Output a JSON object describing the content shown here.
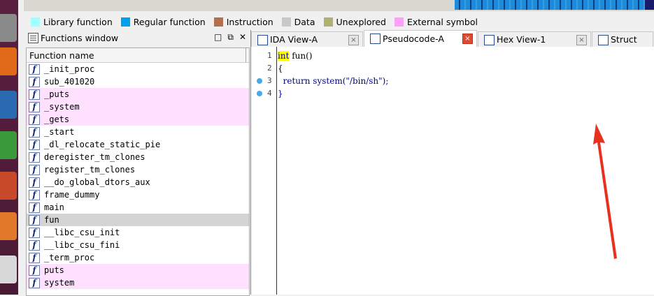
{
  "legend": [
    {
      "label": "Library function",
      "color": "#a0ffff"
    },
    {
      "label": "Regular function",
      "color": "#00a0f0"
    },
    {
      "label": "Instruction",
      "color": "#b07050"
    },
    {
      "label": "Data",
      "color": "#c8c8c8"
    },
    {
      "label": "Unexplored",
      "color": "#b0b070"
    },
    {
      "label": "External symbol",
      "color": "#ffa0ff"
    }
  ],
  "functions_window": {
    "title": "Functions window",
    "buttons": [
      "□",
      "⧉",
      "✕"
    ],
    "column_header": "Function name",
    "items": [
      {
        "name": "_init_proc",
        "type": "regular"
      },
      {
        "name": "sub_401020",
        "type": "regular"
      },
      {
        "name": "_puts",
        "type": "external"
      },
      {
        "name": "_system",
        "type": "external"
      },
      {
        "name": "_gets",
        "type": "external"
      },
      {
        "name": "_start",
        "type": "regular"
      },
      {
        "name": "_dl_relocate_static_pie",
        "type": "regular"
      },
      {
        "name": "deregister_tm_clones",
        "type": "regular"
      },
      {
        "name": "register_tm_clones",
        "type": "regular"
      },
      {
        "name": "__do_global_dtors_aux",
        "type": "regular"
      },
      {
        "name": "frame_dummy",
        "type": "regular"
      },
      {
        "name": "main",
        "type": "regular"
      },
      {
        "name": "fun",
        "type": "selected"
      },
      {
        "name": "__libc_csu_init",
        "type": "regular"
      },
      {
        "name": "__libc_csu_fini",
        "type": "regular"
      },
      {
        "name": "_term_proc",
        "type": "regular"
      },
      {
        "name": "puts",
        "type": "external"
      },
      {
        "name": "system",
        "type": "external"
      }
    ]
  },
  "tabs": [
    {
      "label": "IDA View-A",
      "active": false,
      "closable": true
    },
    {
      "label": "Pseudocode-A",
      "active": true,
      "closable": true
    },
    {
      "label": "Hex View-1",
      "active": false,
      "closable": true
    },
    {
      "label": "Struct",
      "active": false,
      "closable": false
    }
  ],
  "pseudocode": {
    "lines": [
      {
        "num": "1",
        "breakpoint": false,
        "parts": [
          {
            "t": "int",
            "c": "kw hl"
          },
          {
            "t": " fun()",
            "c": ""
          }
        ]
      },
      {
        "num": "2",
        "breakpoint": false,
        "parts": [
          {
            "t": "{",
            "c": ""
          }
        ]
      },
      {
        "num": "3",
        "breakpoint": true,
        "parts": [
          {
            "t": "  return ",
            "c": "kw"
          },
          {
            "t": "system(",
            "c": "kw"
          },
          {
            "t": "\"/bin/sh\"",
            "c": "str"
          },
          {
            "t": ");",
            "c": "kw"
          }
        ]
      },
      {
        "num": "4",
        "breakpoint": true,
        "parts": [
          {
            "t": "}",
            "c": "kw"
          }
        ]
      }
    ]
  },
  "annotation_color": "#e8301e"
}
